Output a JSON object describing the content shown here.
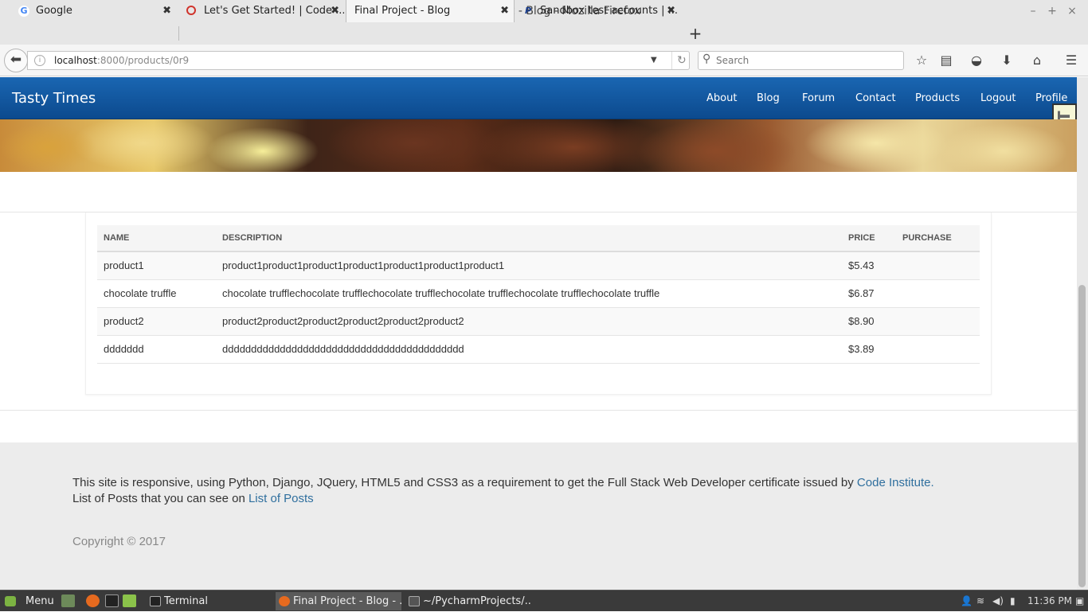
{
  "browser": {
    "window_title": "Final Project - Blog - Mozilla Firefox",
    "tabs": [
      {
        "label": "Google",
        "favicon": "G"
      },
      {
        "label": "Let's Get Started! | Code ...",
        "favicon": "O"
      },
      {
        "label": "Final Project - Blog",
        "favicon": ""
      },
      {
        "label": "Sandbox test accounts | ...",
        "favicon": "P"
      }
    ],
    "url_host": "localhost",
    "url_path": ":8000/products/0r9",
    "search_placeholder": "Search",
    "close_glyph": "✖",
    "newtab_glyph": "+"
  },
  "site": {
    "brand": "Tasty Times",
    "nav": [
      "About",
      "Blog",
      "Forum",
      "Contact",
      "Products",
      "Logout",
      "Profile"
    ],
    "debug_toolbar": "DjDT"
  },
  "products": {
    "headers": [
      "NAME",
      "DESCRIPTION",
      "PRICE",
      "PURCHASE"
    ],
    "rows": [
      {
        "name": "product1",
        "description": "product1product1product1product1product1product1product1",
        "price": "$5.43",
        "purchase": ""
      },
      {
        "name": "chocolate truffle",
        "description": "chocolate trufflechocolate trufflechocolate trufflechocolate trufflechocolate trufflechocolate truffle",
        "price": "$6.87",
        "purchase": ""
      },
      {
        "name": "product2",
        "description": "product2product2product2product2product2product2",
        "price": "$8.90",
        "purchase": ""
      },
      {
        "name": "ddddddd",
        "description": "dddddddddddddddddddddddddddddddddddddddddd",
        "price": "$3.89",
        "purchase": ""
      }
    ]
  },
  "footer": {
    "line1_text": "This site is responsive, using Python, Django, JQuery, HTML5 and CSS3 as a requirement to get the Full Stack Web Developer certificate issued by ",
    "line1_link": "Code Institute.",
    "line2_text": "List of Posts that you can see on ",
    "line2_link": "List of Posts",
    "copyright": "Copyright © 2017"
  },
  "taskbar": {
    "menu_label": "Menu",
    "windows": [
      "Terminal",
      "Final Project - Blog - ...",
      "~/PycharmProjects/..."
    ],
    "clock": "11:36 PM"
  },
  "colors": {
    "site_nav": "#0c4a8e",
    "link": "#2f6f9e",
    "footer_bg": "#ececec"
  }
}
